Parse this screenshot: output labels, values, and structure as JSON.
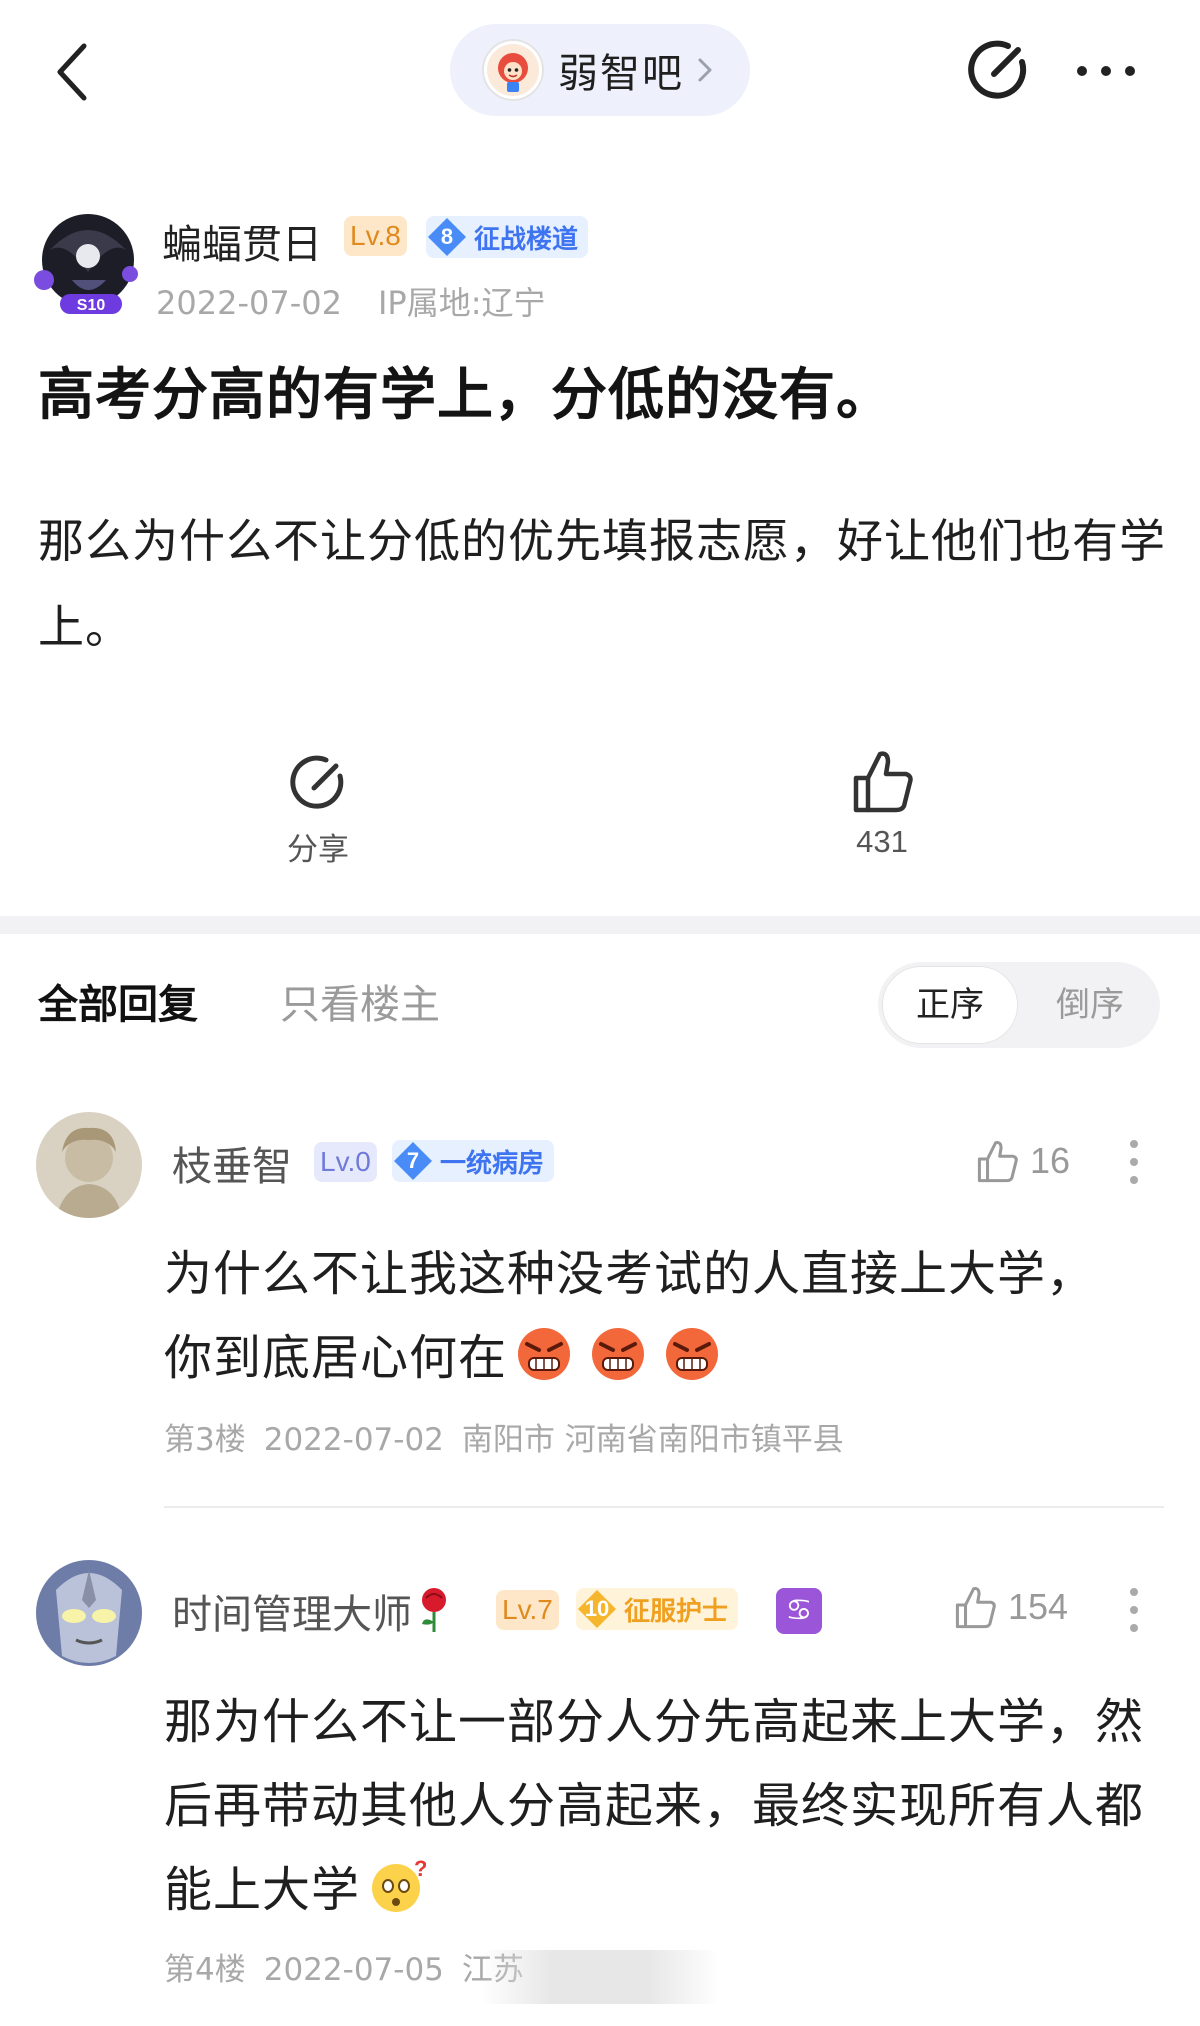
{
  "topbar": {
    "forum_name": "弱智吧"
  },
  "post": {
    "author": {
      "name": "蝙蝠贯日",
      "level": "Lv.8",
      "title_level": "8",
      "title": "征战楼道"
    },
    "date": "2022-07-02",
    "ip_location": "IP属地:辽宁",
    "title": "高考分高的有学上，分低的没有。",
    "body": "那么为什么不让分低的优先填报志愿，好让他们也有学上。",
    "actions": {
      "share_label": "分享",
      "like_count": "431"
    }
  },
  "reply_section": {
    "tab_all": "全部回复",
    "tab_owner_only": "只看楼主",
    "sort_asc": "正序",
    "sort_desc": "倒序"
  },
  "replies": [
    {
      "name": "枝垂智",
      "level": "Lv.0",
      "title_level": "7",
      "title": "一统病房",
      "likes": "16",
      "text_line1": "为什么不让我这种没考试的人直接上大学，",
      "text_line2": "你到底居心何在",
      "emojis": [
        "angry-face-emoji",
        "angry-face-emoji",
        "angry-face-emoji"
      ],
      "floor": "第3楼",
      "date": "2022-07-02",
      "location": "南阳市 河南省南阳市镇平县"
    },
    {
      "name": "时间管理大师",
      "level": "Lv.7",
      "title_level": "10",
      "title": "征服护士",
      "likes": "154",
      "text": "那为什么不让一部分人分先高起来上大学，然后再带动其他人分高起来，最终实现所有人都能上大学",
      "emojis": [
        "confused-face-emoji"
      ],
      "floor": "第4楼",
      "date": "2022-07-05",
      "location": "江苏"
    }
  ],
  "colors": {
    "accent_blue": "#3f74f0",
    "level_orange": "#e08a1e",
    "level_purple": "#6f7ad9",
    "gold_title": "#f0a020",
    "zodiac_purple": "#9b55d8"
  }
}
